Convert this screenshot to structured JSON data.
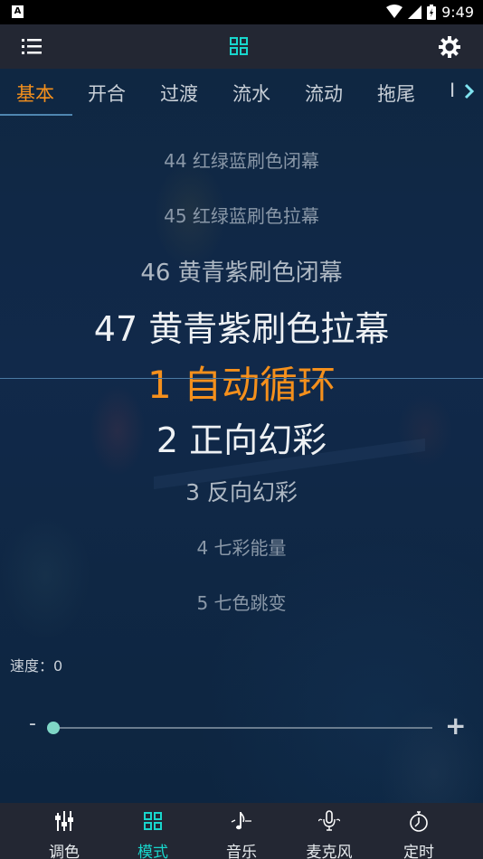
{
  "status_bar": {
    "app_badge": "A",
    "time": "9:49"
  },
  "toolbar": {
    "menu_icon": "list-icon",
    "mode_icon": "grid-icon",
    "settings_icon": "gear-icon"
  },
  "tabs": [
    {
      "label": "基本",
      "active": true
    },
    {
      "label": "开合",
      "active": false
    },
    {
      "label": "过渡",
      "active": false
    },
    {
      "label": "流水",
      "active": false
    },
    {
      "label": "流动",
      "active": false
    },
    {
      "label": "拖尾",
      "active": false
    },
    {
      "label": "I",
      "active": false
    }
  ],
  "picker": {
    "items": [
      "44 红绿蓝刷色闭幕",
      "45 红绿蓝刷色拉幕",
      "46 黄青紫刷色闭幕",
      "47 黄青紫刷色拉幕",
      "1 自动循环",
      "2 正向幻彩",
      "3 反向幻彩",
      "4 七彩能量",
      "5 七色跳变"
    ],
    "selected": "1 自动循环"
  },
  "speed": {
    "label": "速度：0",
    "value": 0,
    "minus_label": "-",
    "plus_label": "+"
  },
  "bottom_nav": [
    {
      "label": "调色",
      "icon": "sliders-icon",
      "active": false
    },
    {
      "label": "模式",
      "icon": "grid-icon",
      "active": true
    },
    {
      "label": "音乐",
      "icon": "music-note-icon",
      "active": false
    },
    {
      "label": "麦克风",
      "icon": "microphone-icon",
      "active": false
    },
    {
      "label": "定时",
      "icon": "timer-icon",
      "active": false
    }
  ],
  "colors": {
    "accent_orange": "#f5901c",
    "accent_teal": "#18d6cc",
    "bar_bg": "#232733",
    "slider_thumb": "#7fd6c6"
  }
}
